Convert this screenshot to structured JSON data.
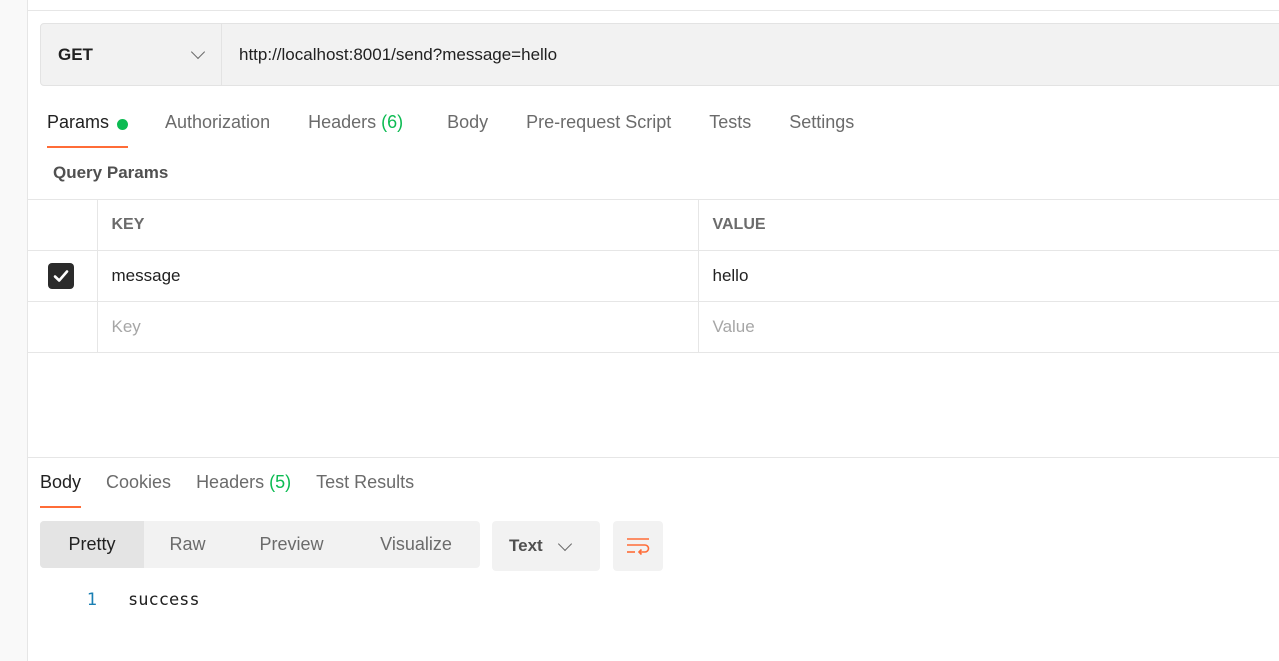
{
  "request": {
    "method": "GET",
    "url": "http://localhost:8001/send?message=hello"
  },
  "request_tabs": [
    {
      "label": "Params",
      "active": true,
      "indicator": "green-dot"
    },
    {
      "label": "Authorization"
    },
    {
      "label": "Headers",
      "count": "(6)"
    },
    {
      "label": "Body"
    },
    {
      "label": "Pre-request Script"
    },
    {
      "label": "Tests"
    },
    {
      "label": "Settings"
    }
  ],
  "params": {
    "title": "Query Params",
    "columns": [
      "KEY",
      "VALUE"
    ],
    "rows": [
      {
        "checked": true,
        "key": "message",
        "value": "hello"
      }
    ],
    "placeholders": {
      "key": "Key",
      "value": "Value"
    }
  },
  "response_tabs": [
    {
      "label": "Body",
      "active": true
    },
    {
      "label": "Cookies"
    },
    {
      "label": "Headers",
      "count": "(5)"
    },
    {
      "label": "Test Results"
    }
  ],
  "view_modes": [
    "Pretty",
    "Raw",
    "Preview",
    "Visualize"
  ],
  "active_view_mode": "Pretty",
  "format": "Text",
  "response_body": {
    "line_number": "1",
    "text": "success"
  },
  "colors": {
    "accent": "#ff6c37",
    "success": "#0cbb52",
    "line_number": "#1a7fb3"
  },
  "icons": {
    "method_dropdown": "chevron-down-icon",
    "format_dropdown": "chevron-down-icon",
    "wrap": "wrap-lines-icon",
    "checkbox": "checkmark-icon"
  }
}
